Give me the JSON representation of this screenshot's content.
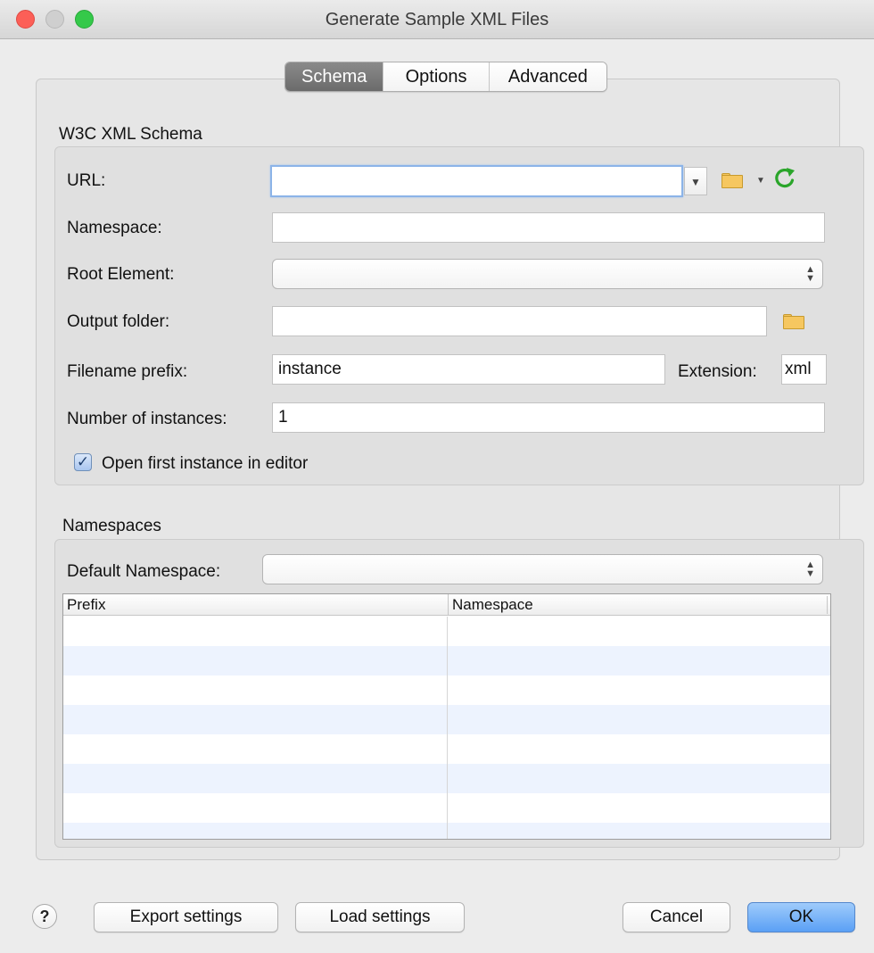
{
  "window": {
    "title": "Generate Sample XML Files"
  },
  "tabs": [
    {
      "label": "Schema",
      "active": true
    },
    {
      "label": "Options",
      "active": false
    },
    {
      "label": "Advanced",
      "active": false
    }
  ],
  "schema": {
    "section_title": "W3C XML Schema",
    "url_label": "URL:",
    "url_value": "",
    "namespace_label": "Namespace:",
    "namespace_value": "",
    "root_element_label": "Root Element:",
    "root_element_value": "",
    "output_folder_label": "Output folder:",
    "output_folder_value": "",
    "filename_prefix_label": "Filename prefix:",
    "filename_prefix_value": "instance",
    "extension_label": "Extension:",
    "extension_value": "xml",
    "instances_label": "Number of instances:",
    "instances_value": "1",
    "open_first_label": "Open first instance in editor",
    "open_first_checked": true
  },
  "namespaces": {
    "section_title": "Namespaces",
    "default_ns_label": "Default Namespace:",
    "default_ns_value": "",
    "table": {
      "columns": [
        "Prefix",
        "Namespace"
      ],
      "rows": []
    }
  },
  "footer": {
    "help_label": "?",
    "export_label": "Export settings",
    "load_label": "Load settings",
    "cancel_label": "Cancel",
    "ok_label": "OK"
  },
  "colors": {
    "accent": "#5aa0f5",
    "reload_icon": "#2aa52a",
    "folder_icon": "#f6c760"
  },
  "icons": [
    "help-icon",
    "folder-icon",
    "reload-icon",
    "dropdown-arrow-icon",
    "check-icon"
  ]
}
